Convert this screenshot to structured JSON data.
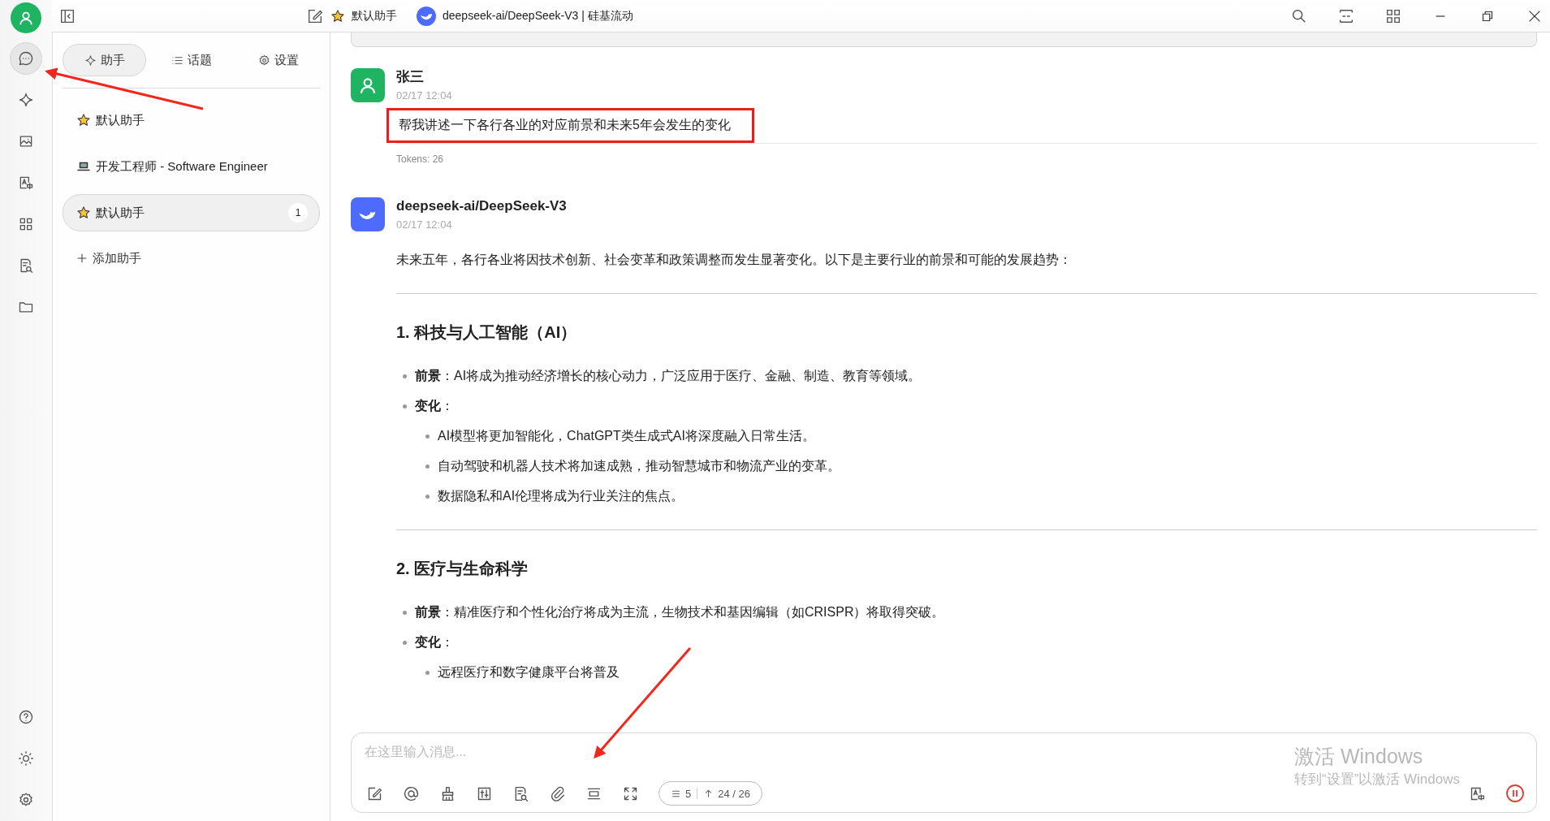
{
  "titlebar": {
    "assistant": "默认助手",
    "model": "deepseek-ai/DeepSeek-V3 | 硅基流动"
  },
  "rail": {
    "top": [
      {
        "kind": "chat",
        "selected": true
      },
      {
        "kind": "agents",
        "selected": false
      },
      {
        "kind": "paint",
        "selected": false
      },
      {
        "kind": "translate",
        "selected": false
      },
      {
        "kind": "apps",
        "selected": false
      },
      {
        "kind": "knowledge",
        "selected": false
      },
      {
        "kind": "files",
        "selected": false
      }
    ],
    "bottom": [
      {
        "kind": "help",
        "selected": false
      },
      {
        "kind": "theme",
        "selected": false
      },
      {
        "kind": "settings",
        "selected": false
      }
    ]
  },
  "tabs": [
    {
      "kind": "assistants",
      "label": "助手",
      "selected": true
    },
    {
      "kind": "topics",
      "label": "话题",
      "selected": false
    },
    {
      "kind": "settings",
      "label": "设置",
      "selected": false
    }
  ],
  "assistants": [
    {
      "kind": "star",
      "label": "默认助手",
      "selected": false
    },
    {
      "kind": "laptop",
      "label": "开发工程师 - Software Engineer",
      "selected": false
    },
    {
      "kind": "star",
      "label": "默认助手",
      "selected": true,
      "badge": "1"
    }
  ],
  "add_assistant": "添加助手",
  "messages": [
    {
      "kind": "user",
      "name": "张三",
      "time": "02/17 12:04",
      "highlighted": true,
      "text": "帮我讲述一下各行各业的对应前景和未来5年会发生的变化",
      "tokens": "Tokens: 26"
    },
    {
      "kind": "model",
      "name": "deepseek-ai/DeepSeek-V3",
      "time": "02/17 12:04",
      "blocks": [
        {
          "kind": "paragraph",
          "text": "未来五年，各行各业将因技术创新、社会变革和政策调整而发生显著变化。以下是主要行业的前景和可能的发展趋势："
        },
        {
          "kind": "rule"
        },
        {
          "kind": "heading",
          "text": "1. 科技与人工智能（AI）"
        },
        {
          "kind": "bullets",
          "items": [
            {
              "text": "**前景**：AI将成为推动经济增长的核心动力，广泛应用于医疗、金融、制造、教育等领域。"
            },
            {
              "text": "**变化**：",
              "children": [
                {
                  "text": "AI模型将更加智能化，ChatGPT类生成式AI将深度融入日常生活。"
                },
                {
                  "text": "自动驾驶和机器人技术将加速成熟，推动智慧城市和物流产业的变革。"
                },
                {
                  "text": "数据隐私和AI伦理将成为行业关注的焦点。"
                }
              ]
            }
          ]
        },
        {
          "kind": "rule"
        },
        {
          "kind": "heading",
          "text": "2. 医疗与生命科学"
        },
        {
          "kind": "bullets",
          "items": [
            {
              "text": "**前景**：精准医疗和个性化治疗将成为主流，生物技术和基因编辑（如CRISPR）将取得突破。"
            },
            {
              "text": "**变化**：",
              "children": [
                {
                  "text": "远程医疗和数字健康平台将普及"
                }
              ]
            }
          ]
        }
      ]
    }
  ],
  "input": {
    "placeholder": "在这里输入消息...",
    "tools": [
      {
        "kind": "new"
      },
      {
        "kind": "mention"
      },
      {
        "kind": "clear"
      },
      {
        "kind": "sliders"
      },
      {
        "kind": "knowledge"
      },
      {
        "kind": "attach"
      },
      {
        "kind": "fold"
      },
      {
        "kind": "expand"
      }
    ],
    "context_count": "5",
    "token_count": "24 / 26"
  },
  "watermark": {
    "title": "激活 Windows",
    "subtitle": "转到“设置”以激活 Windows"
  }
}
